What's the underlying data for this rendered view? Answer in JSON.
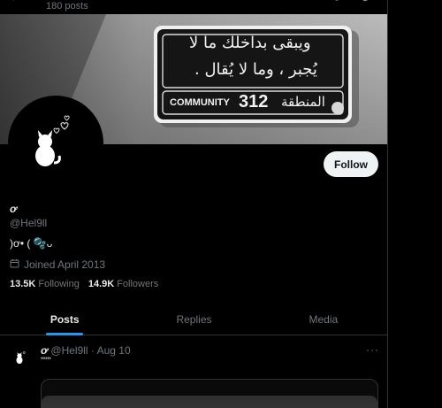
{
  "header": {
    "post_count": "180 posts"
  },
  "banner": {
    "line1": "ويبقى بداخلك ما لا",
    "line2": "يُجبر ، وما لا يُقال .",
    "community_label": "COMMUNITY",
    "community_number": "312",
    "arabic_bottom": "المنطقة"
  },
  "profile": {
    "display_name": "ơ",
    "handle": "@Hel9ll",
    "bio": ")ơ• ( 🫧ᴗ",
    "joined": "Joined April 2013",
    "following_count": "13.5K",
    "following_label": "Following",
    "followers_count": "14.9K",
    "followers_label": "Followers",
    "follow_button": "Follow"
  },
  "tabs": [
    {
      "label": "Posts",
      "active": true
    },
    {
      "label": "Replies",
      "active": false
    },
    {
      "label": "Media",
      "active": false
    }
  ],
  "tweet": {
    "name": "ơ",
    "meta": "@Hel9ll · Aug 10",
    "text": "\"\"\"",
    "more": "···"
  },
  "colors": {
    "accent": "#1d9bf0",
    "background": "#000000",
    "muted": "#71767b"
  }
}
